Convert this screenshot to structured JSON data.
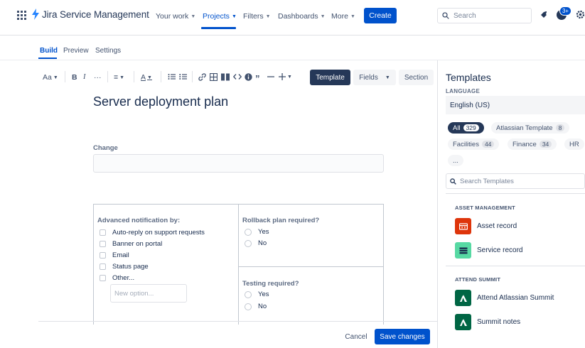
{
  "app": {
    "brand_name": "Jira Service Management"
  },
  "nav": {
    "items": [
      {
        "label": "Your work",
        "active": false
      },
      {
        "label": "Projects",
        "active": true
      },
      {
        "label": "Filters",
        "active": false
      },
      {
        "label": "Dashboards",
        "active": false
      },
      {
        "label": "More",
        "active": false
      }
    ],
    "create_label": "Create",
    "search_placeholder": "Search",
    "notification_badge": "3+"
  },
  "subtabs": [
    "Build",
    "Preview",
    "Settings"
  ],
  "toolbar": {
    "text_style": "Aa",
    "bold": "B",
    "italic": "I",
    "more": "···",
    "align": "≡",
    "color": "A",
    "template_label": "Template",
    "fields_label": "Fields",
    "section_label": "Section"
  },
  "form": {
    "title": "Server deployment plan",
    "change_label": "Change",
    "notification": {
      "label": "Advanced notification by:",
      "options": [
        "Auto-reply on support requests",
        "Banner on portal",
        "Email",
        "Status page",
        "Other..."
      ],
      "new_option_placeholder": "New option..."
    },
    "rollback": {
      "label": "Rollback plan required?",
      "options": [
        "Yes",
        "No"
      ]
    },
    "testing": {
      "label": "Testing required?",
      "options": [
        "Yes",
        "No"
      ]
    }
  },
  "footer": {
    "cancel_label": "Cancel",
    "save_label": "Save changes"
  },
  "templates_panel": {
    "title": "Templates",
    "language_label": "LANGUAGE",
    "language_value": "English (US)",
    "chips": [
      {
        "label": "All",
        "count": "329",
        "active": true
      },
      {
        "label": "Atlassian Template",
        "count": "8",
        "active": false
      },
      {
        "label": "Facilities",
        "count": "44",
        "active": false
      },
      {
        "label": "Finance",
        "count": "34",
        "active": false
      },
      {
        "label": "HR",
        "count": "",
        "active": false
      },
      {
        "label": "...",
        "count": "",
        "active": false
      }
    ],
    "search_placeholder": "Search Templates",
    "categories": [
      {
        "name": "ASSET MANAGEMENT",
        "items": [
          {
            "name": "Asset record",
            "icon": "asset-record-icon",
            "color": "#de350b"
          },
          {
            "name": "Service record",
            "icon": "service-record-icon",
            "color": "#57d9a3"
          }
        ]
      },
      {
        "name": "ATTEND SUMMIT",
        "items": [
          {
            "name": "Attend Atlassian Summit",
            "icon": "atlassian-summit-icon",
            "color": "#006644"
          },
          {
            "name": "Summit notes",
            "icon": "summit-notes-icon",
            "color": "#006644"
          }
        ]
      }
    ]
  },
  "colors": {
    "primary": "#0052cc",
    "dark": "#253858"
  }
}
